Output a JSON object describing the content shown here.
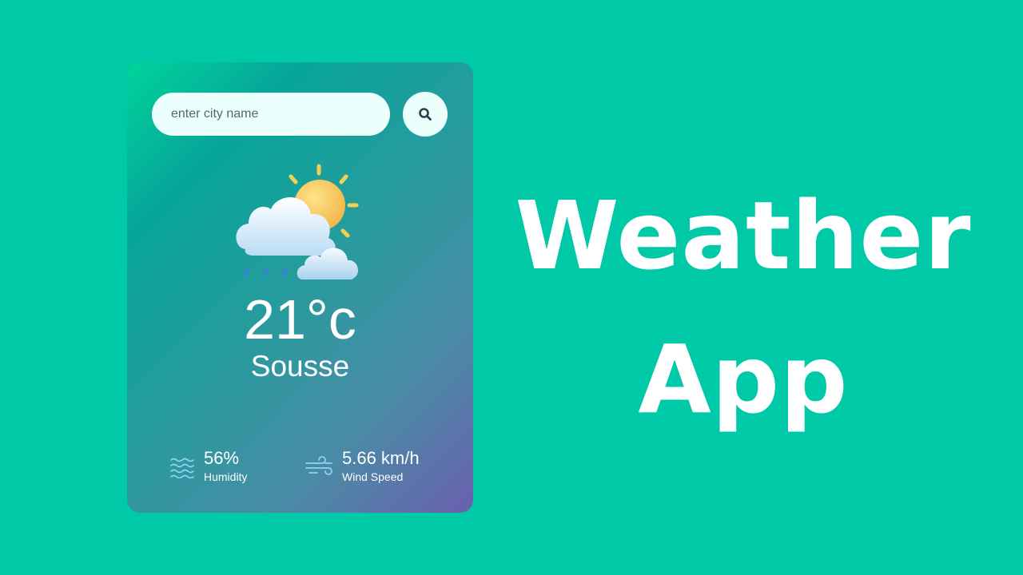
{
  "search": {
    "placeholder": "enter city name",
    "icon": "search-icon"
  },
  "weather": {
    "icon": "partly-cloudy-rain-icon",
    "temperature": "21°c",
    "city": "Sousse"
  },
  "details": {
    "humidity": {
      "value": "56%",
      "label": "Humidity",
      "icon": "waves-icon"
    },
    "wind": {
      "value": "5.66 km/h",
      "label": "Wind Speed",
      "icon": "wind-icon"
    }
  },
  "headline": {
    "line1": "Weather",
    "line2": "App"
  },
  "colors": {
    "background": "#00c9a7",
    "card_gradient_start": "#00d49a",
    "card_gradient_end": "#6a5fae",
    "input_background": "#ebfffc",
    "text": "#ffffff"
  }
}
